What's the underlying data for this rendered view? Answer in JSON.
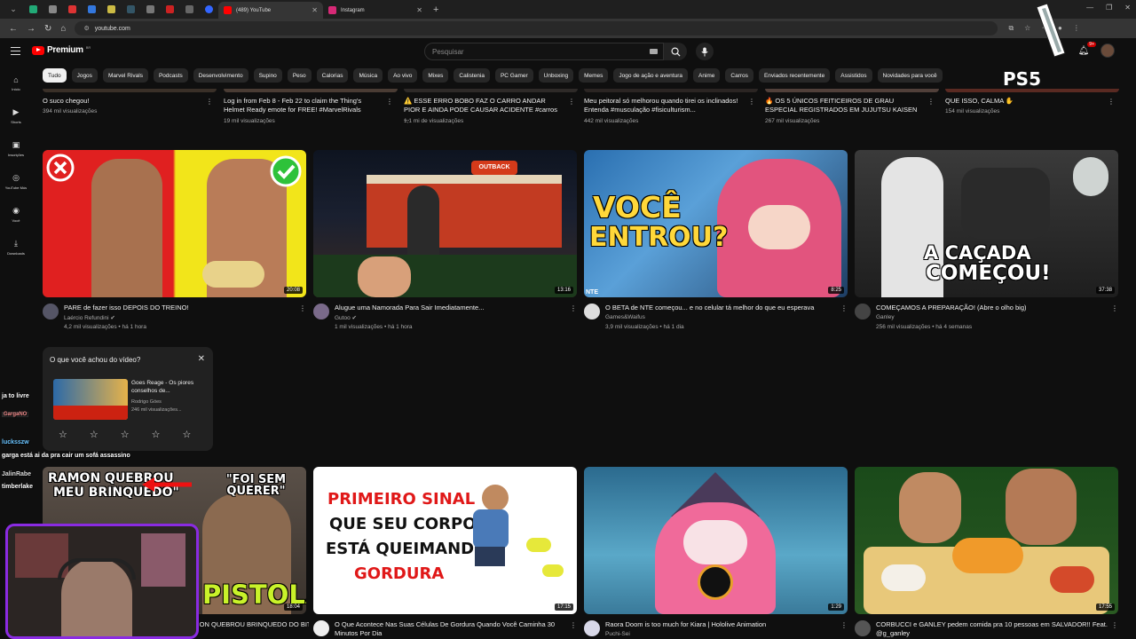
{
  "browser": {
    "tabs": [
      {
        "label": "(489) YouTube",
        "active": true
      },
      {
        "label": "Instagram",
        "active": false
      }
    ],
    "url": "youtube.com"
  },
  "header": {
    "logo_text": "Premium",
    "logo_sup": "BR",
    "search_placeholder": "Pesquisar",
    "notif_count": "9+"
  },
  "chips": [
    "Tudo",
    "Jogos",
    "Marvel Rivals",
    "Podcasts",
    "Desenvolvimento",
    "Supino",
    "Peso",
    "Calorias",
    "Música",
    "Ao vivo",
    "Mixes",
    "Calistenia",
    "PC Gamer",
    "Unboxing",
    "Memes",
    "Jogo de ação e aventura",
    "Anime",
    "Carros",
    "Enviados recentemente",
    "Assistidos",
    "Novidades para você"
  ],
  "sidebar": [
    {
      "label": "Início",
      "icon": "home-icon"
    },
    {
      "label": "Shorts",
      "icon": "shorts-icon"
    },
    {
      "label": "Inscrições",
      "icon": "subscriptions-icon"
    },
    {
      "label": "YouTube Mús",
      "icon": "music-icon"
    },
    {
      "label": "Você",
      "icon": "you-icon"
    },
    {
      "label": "Downloads",
      "icon": "download-icon"
    }
  ],
  "top_row": [
    {
      "title": "O suco chegou!",
      "meta": "394 mil visualizações"
    },
    {
      "title": "Log in from Feb 8 - Feb 22 to claim the Thing's Helmet Ready emote for FREE! #MarvelRivals",
      "meta": "19 mil visualizações"
    },
    {
      "title": "⚠️ ESSE ERRO BOBO FAZ O CARRO ANDAR PIOR E AINDA PODE CAUSAR ACIDENTE #carros ...",
      "meta": "1,1 mi de visualizações"
    },
    {
      "title": "Meu peitoral só melhorou quando tirei os inclinados! Entenda #musculação #fisiculturism...",
      "meta": "442 mil visualizações"
    },
    {
      "title": "🔥 OS 5 ÚNICOS FEITICEIROS DE GRAU ESPECIAL REGISTRADOS EM JUJUTSU KAISEN",
      "meta": "267 mil visualizações"
    },
    {
      "title": "QUE ISSO, CALMA ✋",
      "meta": "154 mil visualizações"
    }
  ],
  "videos_row1": [
    {
      "title": "PARE de fazer isso DEPOIS DO TREINO!",
      "channel": "Laércio Refundini ✔",
      "meta": "4,2 mil visualizações • há 1 hora",
      "duration": "20:08"
    },
    {
      "title": "Alugue uma Namorada Para Sair Imediatamente...",
      "channel": "Gutoo ✔",
      "meta": "1 mil visualizações • há 1 hora",
      "duration": "13:16"
    },
    {
      "title": "O BETA de NTE começou... e no celular tá melhor do que eu esperava",
      "channel": "Games&Waifus",
      "meta": "3,9 mil visualizações • há 1 dia",
      "duration": "8:25"
    },
    {
      "title": "COMEÇAMOS A PREPARAÇÃO! (Abre o olho big)",
      "channel": "Ganley",
      "meta": "256 mil visualizações • há 4 semanas",
      "duration": "37:38"
    }
  ],
  "videos_row2": [
    {
      "title": "RAMON QUEBROU BRINQUEDO DO BITELO + TREINO DE PERNA BRUTAL",
      "duration": "18:04"
    },
    {
      "title": "O Que Acontece Nas Suas Células De Gordura Quando Você Caminha 30 Minutos Por Dia",
      "duration": "17:15"
    },
    {
      "title": "Raora Doom is too much for Kiara | Hololive Animation",
      "channel": "Puchi-Sei",
      "duration": "1:29"
    },
    {
      "title": "CORBUCCI e GANLEY pedem comida pra 10 pessoas em SALVADOR!! Feat. @g_ganley",
      "duration": "17:55"
    }
  ],
  "thumb_texts": {
    "v3": [
      "VOCÊ",
      "ENTROU?"
    ],
    "v3_brand": "NTE",
    "v4": [
      "A CAÇADA",
      "COMEÇOU!"
    ],
    "r1": [
      "RAMON QUEBROU",
      "MEU BRINQUEDO\"",
      "\"FOI SEM QUERER\"",
      "PISTOLA"
    ],
    "r2": [
      "PRIMEIRO SINAL",
      "QUE SEU CORPO",
      "ESTÁ QUEIMANDO",
      "GORDURA"
    ],
    "v2_sign": "OUTBACK"
  },
  "survey": {
    "title": "O que você achou do vídeo?",
    "video_title": "Goes Reage - Os piores conselhos de...",
    "channel": "Rodrigo Góes",
    "meta": "246 mil visualizações..."
  },
  "stream_chat": [
    "ja to livre",
    "GargaNO",
    "lucksszw",
    "garga está ai da pra cair um sofá assassino",
    "JalinRabe",
    "timberlake"
  ],
  "ps5_logo": "PS5"
}
